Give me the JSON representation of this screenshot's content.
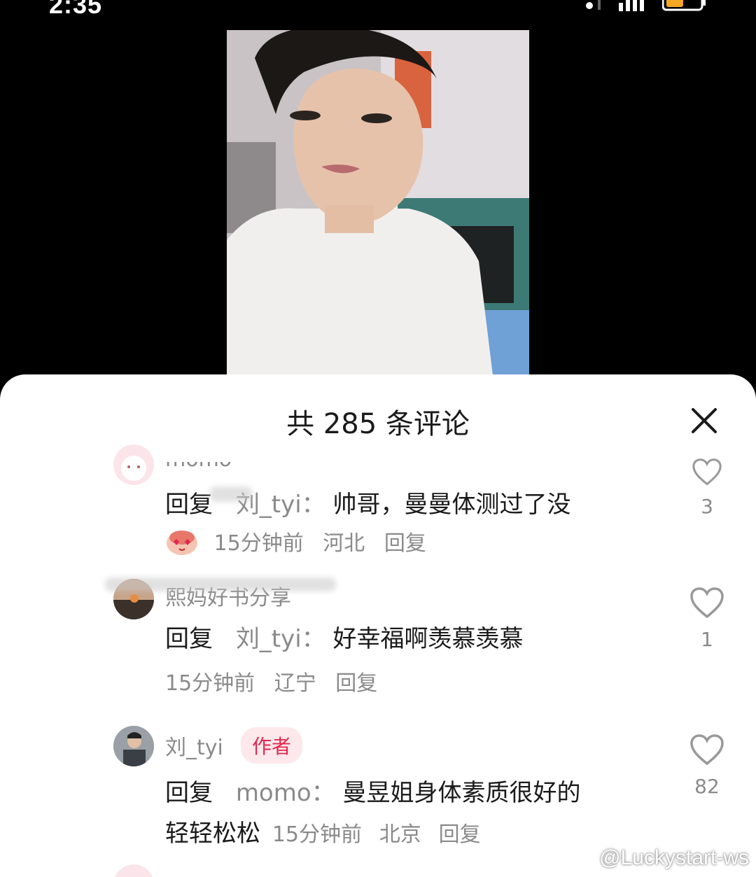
{
  "status_bar": {
    "time": "2:35"
  },
  "comments_sheet": {
    "title": "共 285 条评论",
    "close_icon": "close-icon",
    "comments": [
      {
        "username": "momo",
        "reply_prefix": "回复",
        "reply_to": "刘_tyi：",
        "text": "帅哥，曼曼体测过了没",
        "emoji": "heart-eyes-emoji",
        "time": "15分钟前",
        "location": "河北",
        "reply_label": "回复",
        "like_count": "3"
      },
      {
        "username": "熙妈好书分享",
        "reply_prefix": "回复",
        "reply_to": "刘_tyi：",
        "text": "好幸福啊羡慕羡慕",
        "time": "15分钟前",
        "location": "辽宁",
        "reply_label": "回复",
        "like_count": "1"
      },
      {
        "username": "刘_tyi",
        "badge": "作者",
        "reply_prefix": "回复",
        "reply_to": "momo：",
        "text_line1": "曼昱姐身体素质很好的",
        "text_line2": "轻轻松松",
        "time": "15分钟前",
        "location": "北京",
        "reply_label": "回复",
        "like_count": "82"
      }
    ]
  },
  "watermark": {
    "text": "@Luckystart-ws",
    "icon": "weibo-icon"
  },
  "colors": {
    "accent": "#e0284f",
    "badge_bg": "#fde8ec",
    "meta_gray": "#8a8a8a"
  }
}
